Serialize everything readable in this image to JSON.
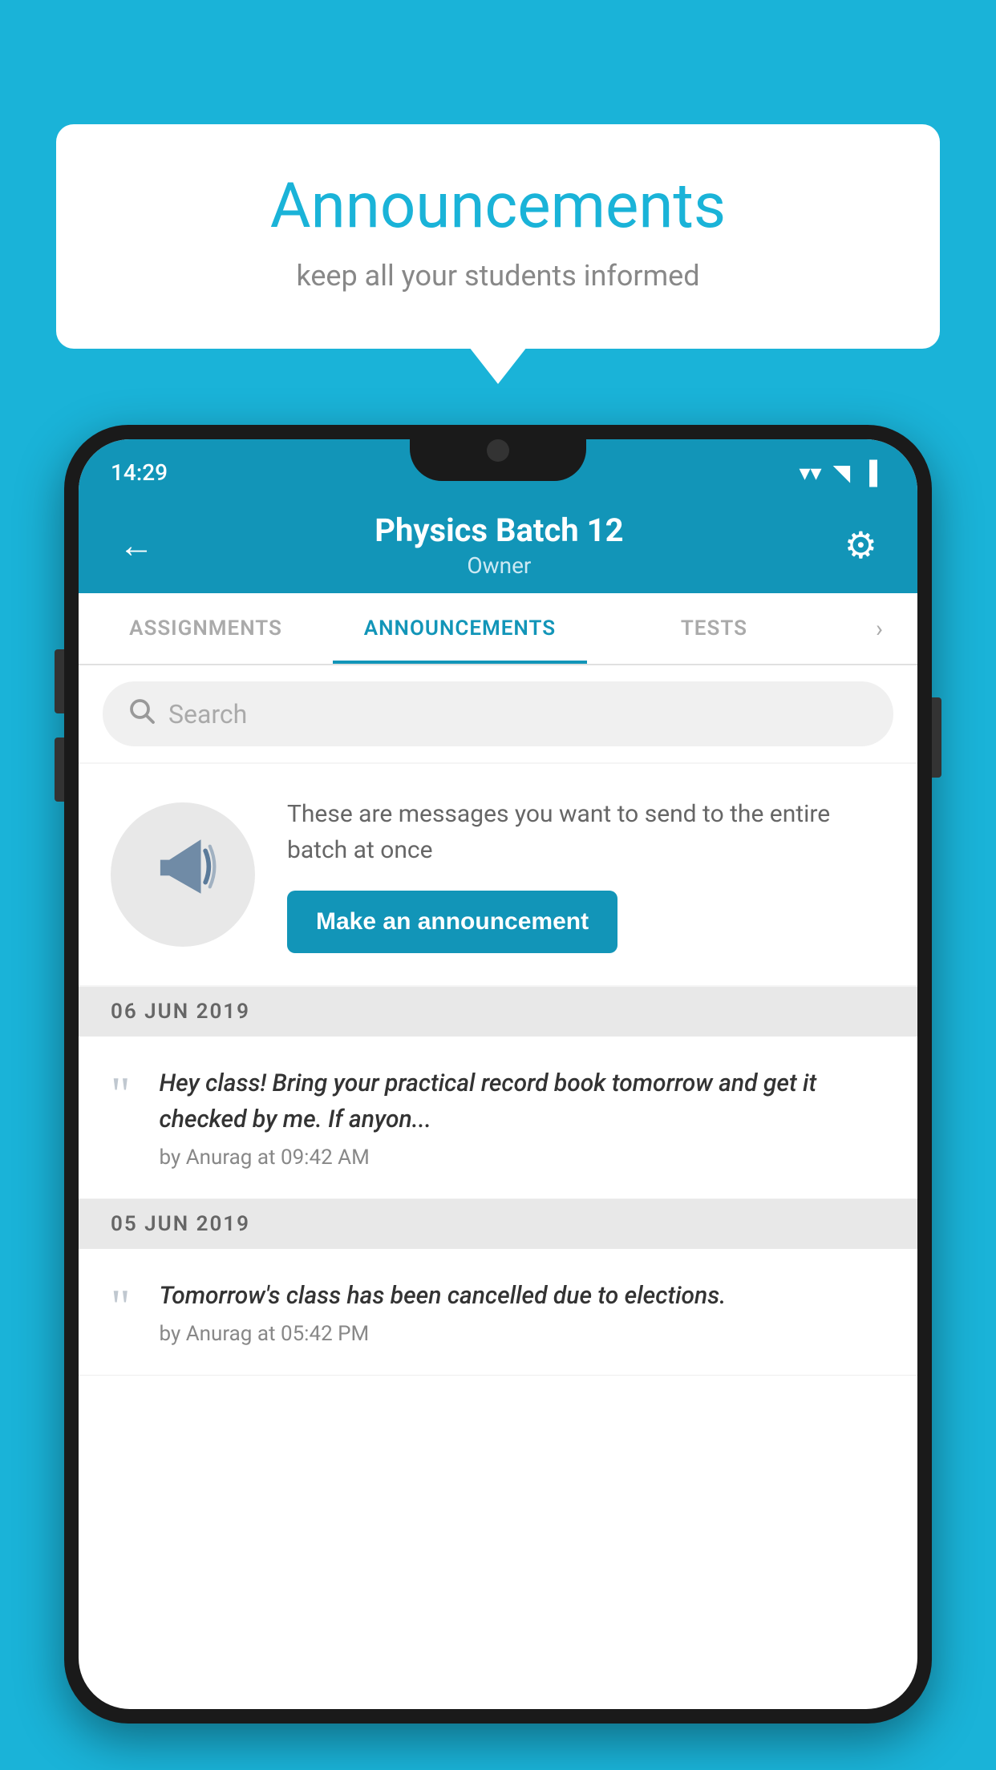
{
  "background_color": "#1ab3d8",
  "speech_bubble": {
    "title": "Announcements",
    "subtitle": "keep all your students informed"
  },
  "phone": {
    "status_bar": {
      "time": "14:29",
      "wifi": "▼",
      "signal": "▲",
      "battery": "▮"
    },
    "header": {
      "title": "Physics Batch 12",
      "subtitle": "Owner",
      "back_label": "←",
      "settings_label": "⚙"
    },
    "tabs": [
      {
        "label": "ASSIGNMENTS",
        "active": false
      },
      {
        "label": "ANNOUNCEMENTS",
        "active": true
      },
      {
        "label": "TESTS",
        "active": false
      }
    ],
    "search": {
      "placeholder": "Search"
    },
    "announcement_prompt": {
      "description": "These are messages you want to send to the entire batch at once",
      "button_label": "Make an announcement"
    },
    "date_groups": [
      {
        "date": "06  JUN  2019",
        "items": [
          {
            "text": "Hey class! Bring your practical record book tomorrow and get it checked by me. If anyon...",
            "meta": "by Anurag at 09:42 AM"
          }
        ]
      },
      {
        "date": "05  JUN  2019",
        "items": [
          {
            "text": "Tomorrow's class has been cancelled due to elections.",
            "meta": "by Anurag at 05:42 PM"
          }
        ]
      }
    ]
  }
}
